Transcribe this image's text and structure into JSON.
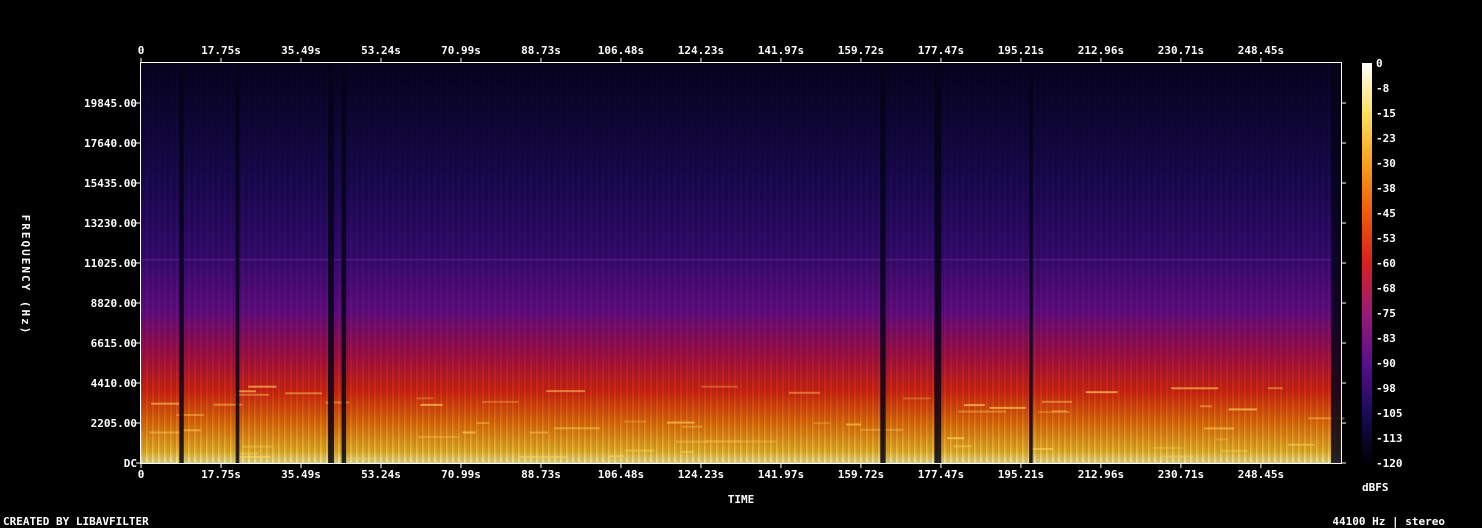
{
  "chart_data": {
    "type": "heatmap",
    "title": "",
    "xlabel": "TIME",
    "ylabel": "FREQUENCY (Hz)",
    "x_tick_labels": [
      "0",
      "17.75s",
      "35.49s",
      "53.24s",
      "70.99s",
      "88.73s",
      "106.48s",
      "124.23s",
      "141.97s",
      "159.72s",
      "177.47s",
      "195.21s",
      "212.96s",
      "230.71s",
      "248.45s"
    ],
    "y_tick_labels": [
      "DC",
      "2205.00",
      "4410.00",
      "6615.00",
      "8820.00",
      "11025.00",
      "13230.00",
      "15435.00",
      "17640.00",
      "19845.00"
    ],
    "y_tick_values": [
      0,
      2205,
      4410,
      6615,
      8820,
      11025,
      13230,
      15435,
      17640,
      19845
    ],
    "xlim": [
      0,
      266.2
    ],
    "ylim": [
      0,
      22050
    ],
    "colorbar": {
      "label": "dBFS",
      "tick_labels": [
        "0",
        "-8",
        "-15",
        "-23",
        "-30",
        "-38",
        "-45",
        "-53",
        "-60",
        "-68",
        "-75",
        "-83",
        "-90",
        "-98",
        "-105",
        "-113",
        "-120"
      ],
      "range": [
        -120,
        0
      ]
    },
    "quiet_regions_s": [
      [
        8.5,
        9.5
      ],
      [
        21.0,
        21.8
      ],
      [
        41.5,
        42.8
      ],
      [
        44.5,
        45.5
      ],
      [
        164.0,
        165.2
      ],
      [
        176.0,
        177.5
      ],
      [
        197.0,
        197.8
      ],
      [
        264.0,
        266.2
      ]
    ]
  },
  "footer": {
    "left": "CREATED BY LIBAVFILTER",
    "right": "44100 Hz | stereo"
  },
  "colors": {
    "background": "#000000",
    "axis": "#ffffff",
    "palette": [
      "#000004",
      "#1a0b5a",
      "#5a0f8c",
      "#9a1a78",
      "#d82020",
      "#f05a0a",
      "#f8a020",
      "#fde060",
      "#ffffff"
    ]
  }
}
